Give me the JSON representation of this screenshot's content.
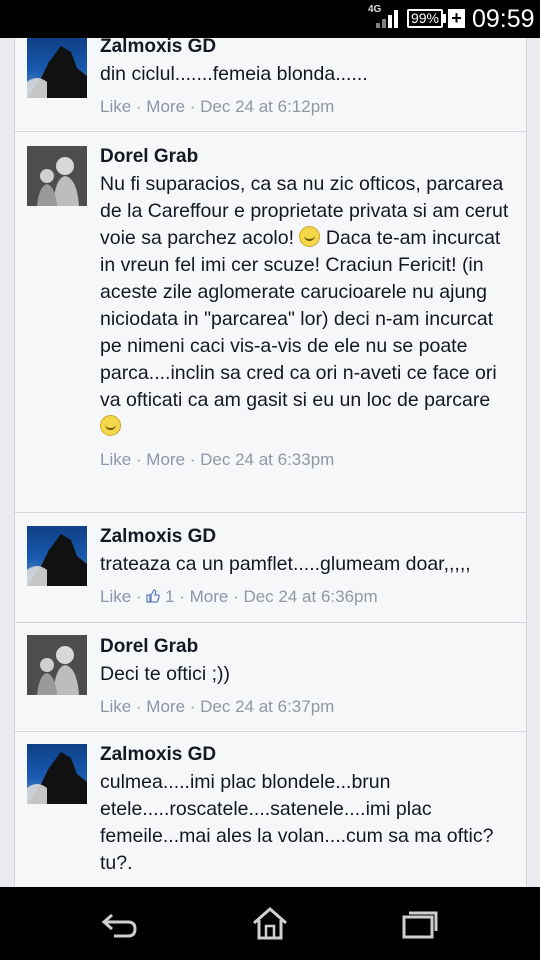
{
  "status_bar": {
    "network": "4G",
    "battery": "99%",
    "time": "09:59"
  },
  "comments": [
    {
      "author": "Zalmoxis GD",
      "avatar": "zalmoxis-avatar",
      "text": "din ciclul.......femeia blonda......",
      "like": "Like",
      "more": "More",
      "time": "Dec 24 at 6:12pm"
    },
    {
      "author": "Dorel Grab",
      "avatar": "dorel-avatar",
      "text_1": "Nu fi suparacios, ca sa nu zic ofticos, parcarea de la Careffour e proprietate privata si am cerut voie sa parchez acolo!",
      "text_2": " Daca te-am incurcat in vreun fel imi cer scuze! Craciun Fericit! (in aceste zile aglomerate carucioarele nu ajung niciodata in \"parcarea\" lor) deci n-am incurcat pe nimeni caci vis-a-vis de ele nu se poate parca....inclin sa cred ca ori n-aveti ce face ori va ofticati ca am gasit si eu un loc de parcare ",
      "like": "Like",
      "more": "More",
      "time": "Dec 24 at 6:33pm"
    },
    {
      "author": "Zalmoxis GD",
      "avatar": "zalmoxis-avatar",
      "text": "trateaza ca un pamflet.....glumeam doar,,,,,",
      "like": "Like",
      "like_count": "1",
      "more": "More",
      "time": "Dec 24 at 6:36pm"
    },
    {
      "author": "Dorel Grab",
      "avatar": "dorel-avatar",
      "text": "Deci te oftici ;))",
      "like": "Like",
      "more": "More",
      "time": "Dec 24 at 6:37pm"
    },
    {
      "author": "Zalmoxis GD",
      "avatar": "zalmoxis-avatar",
      "text": "culmea.....imi plac blondele...brun etele.....roscatele....satenele....imi plac femeile...mai ales la volan....cum sa ma oftic? tu?."
    }
  ],
  "nav_bar": {
    "icons": [
      "back-icon",
      "home-icon",
      "recent-apps-icon"
    ]
  }
}
